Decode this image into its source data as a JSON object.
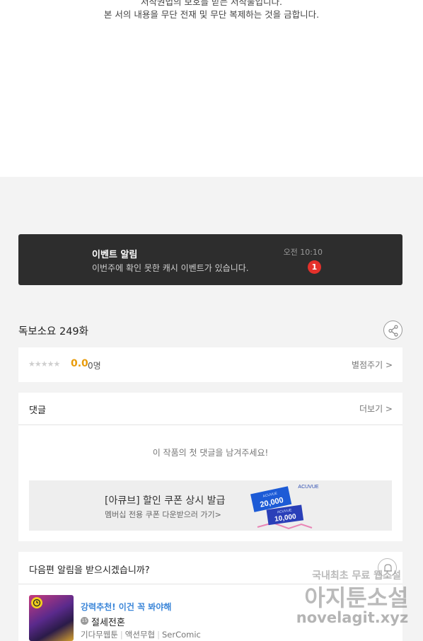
{
  "copyright": {
    "line1": "저작권법의 보호를 받는 저작물입니다.",
    "line2": "본 서의 내용을 무단 전재 및 무단 복제하는 것을 금합니다."
  },
  "event_notice": {
    "title": "이벤트 알림",
    "message": "이번주에 확인 못한 캐시 이벤트가 있습니다.",
    "time": "오전 10:10",
    "badge_count": "1"
  },
  "episode": {
    "title": "독보소요 249화"
  },
  "rating": {
    "stars": "★★★★★",
    "score": "0.0",
    "raters": "0명",
    "rate_label": "별점주기 >"
  },
  "comments": {
    "title": "댓글",
    "more_label": "더보기 >",
    "empty_message": "이 작품의 첫 댓글을 남겨주세요!"
  },
  "ad": {
    "title": "[아큐브] 할인 쿠폰 상시 발급",
    "subtitle": "멤버십 전용 쿠폰 다운받으러 가기>",
    "brand": "ACUVUE",
    "coupon1": "20,000",
    "coupon2": "10,000"
  },
  "next_notice": {
    "title": "다음편 알림을 받으시겠습니까?"
  },
  "recommendation": {
    "tag": "강력추천! 이건 꼭 봐야해",
    "age_badge": "15",
    "name": "절세전혼",
    "meta": [
      "기다무웹툰",
      "액션무협",
      "SerComic"
    ]
  },
  "watermark": {
    "line1": "국내최초 무료 웹소설",
    "line2": "아지툰소설",
    "line3": "novelagit.xyz"
  },
  "colors": {
    "notice_bg": "#2d2d2d",
    "badge_red": "#e4312b",
    "score_orange": "#e89c0c",
    "link_blue": "#3a85d8"
  }
}
